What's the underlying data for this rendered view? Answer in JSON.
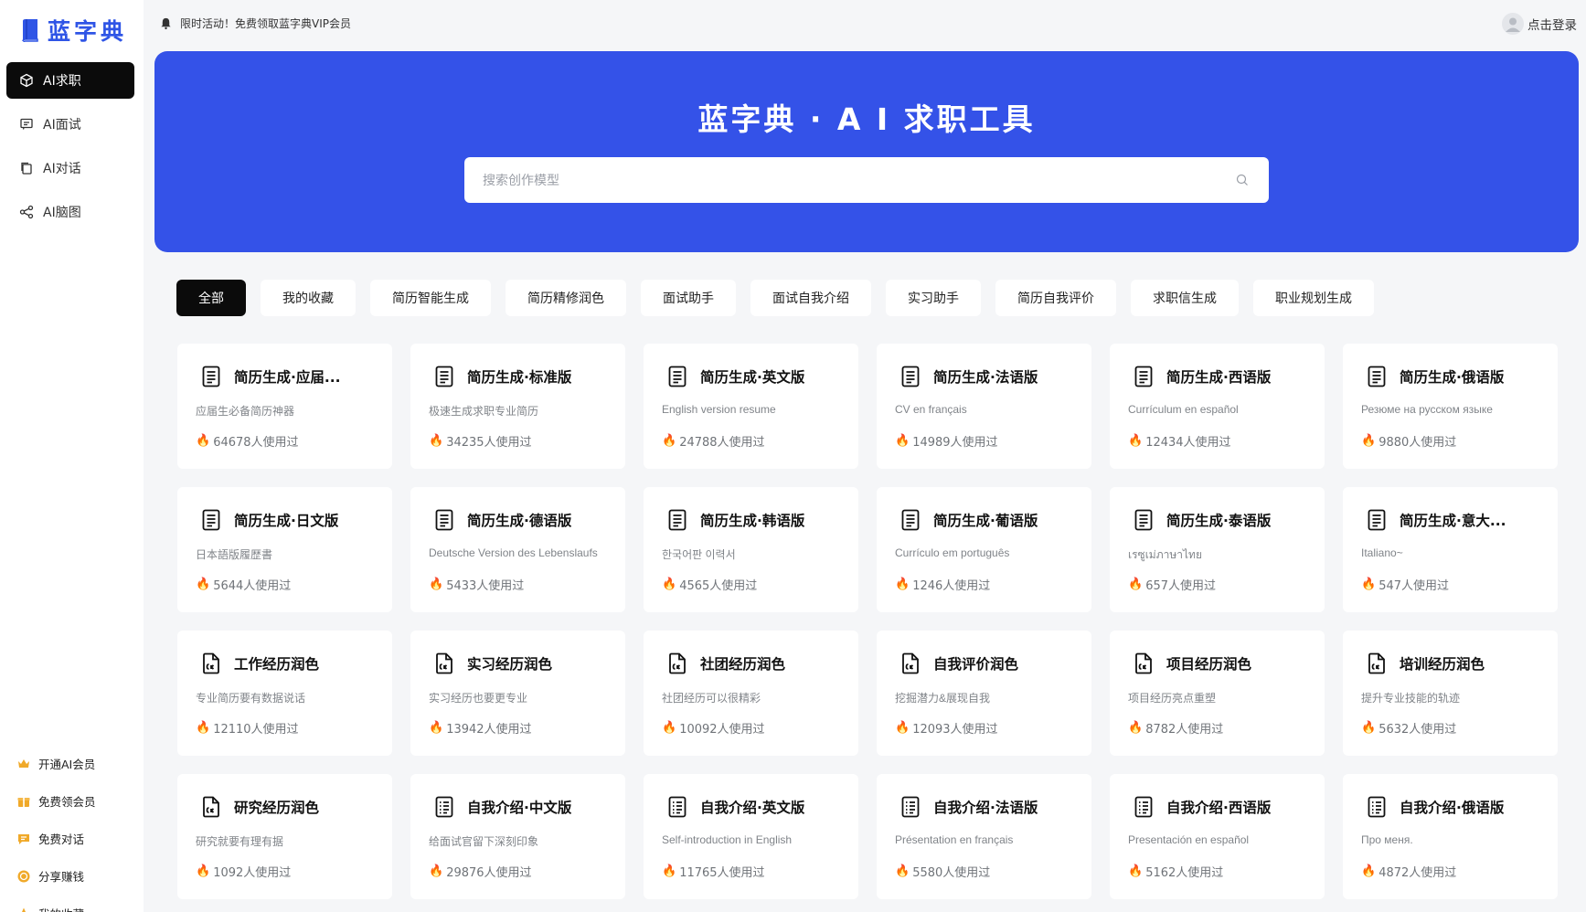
{
  "sidebar": {
    "logo_text": "蓝字典",
    "nav": [
      {
        "label": "AI求职",
        "icon": "cube-icon",
        "active": true
      },
      {
        "label": "AI面试",
        "icon": "message-icon",
        "active": false
      },
      {
        "label": "AI对话",
        "icon": "copy-icon",
        "active": false
      },
      {
        "label": "AI脑图",
        "icon": "mindmap-icon",
        "active": false
      }
    ],
    "bottom": [
      {
        "label": "开通AI会员",
        "icon": "crown-icon",
        "color": "#f0a929"
      },
      {
        "label": "免费领会员",
        "icon": "gift-icon",
        "color": "#f0a929"
      },
      {
        "label": "免费对话",
        "icon": "chat-icon",
        "color": "#f0a929"
      },
      {
        "label": "分享赚钱",
        "icon": "coin-icon",
        "color": "#f0a929"
      },
      {
        "label": "我的收藏",
        "icon": "star-icon",
        "color": "#f0a929"
      }
    ]
  },
  "topbar": {
    "promo": "限时活动！免费领取蓝字典VIP会员",
    "login": "点击登录"
  },
  "hero": {
    "title": "蓝字典 · A I 求职工具",
    "search_placeholder": "搜索创作模型"
  },
  "tabs": [
    {
      "label": "全部",
      "active": true
    },
    {
      "label": "我的收藏",
      "active": false
    },
    {
      "label": "简历智能生成",
      "active": false
    },
    {
      "label": "简历精修润色",
      "active": false
    },
    {
      "label": "面试助手",
      "active": false
    },
    {
      "label": "面试自我介绍",
      "active": false
    },
    {
      "label": "实习助手",
      "active": false
    },
    {
      "label": "简历自我评价",
      "active": false
    },
    {
      "label": "求职信生成",
      "active": false
    },
    {
      "label": "职业规划生成",
      "active": false
    }
  ],
  "cards": [
    {
      "title": "简历生成·应届...",
      "desc": "应届生必备简历神器",
      "usage": "64678人使用过",
      "icon": "resume-icon"
    },
    {
      "title": "简历生成·标准版",
      "desc": "极速生成求职专业简历",
      "usage": "34235人使用过",
      "icon": "resume-icon"
    },
    {
      "title": "简历生成·英文版",
      "desc": "English version resume",
      "usage": "24788人使用过",
      "icon": "resume-icon"
    },
    {
      "title": "简历生成·法语版",
      "desc": "CV en français",
      "usage": "14989人使用过",
      "icon": "resume-icon"
    },
    {
      "title": "简历生成·西语版",
      "desc": "Currículum en español",
      "usage": "12434人使用过",
      "icon": "resume-icon"
    },
    {
      "title": "简历生成·俄语版",
      "desc": "Резюме на русском языке",
      "usage": "9880人使用过",
      "icon": "resume-icon"
    },
    {
      "title": "简历生成·日文版",
      "desc": "日本語版履歴書",
      "usage": "5644人使用过",
      "icon": "resume-icon"
    },
    {
      "title": "简历生成·德语版",
      "desc": "Deutsche Version des Lebenslaufs",
      "usage": "5433人使用过",
      "icon": "resume-icon"
    },
    {
      "title": "简历生成·韩语版",
      "desc": "한국어판 이력서",
      "usage": "4565人使用过",
      "icon": "resume-icon"
    },
    {
      "title": "简历生成·葡语版",
      "desc": "Currículo em português",
      "usage": "1246人使用过",
      "icon": "resume-icon"
    },
    {
      "title": "简历生成·泰语版",
      "desc": "เรซูเม่ภาษาไทย",
      "usage": "657人使用过",
      "icon": "resume-icon"
    },
    {
      "title": "简历生成·意大...",
      "desc": "Italiano~",
      "usage": "547人使用过",
      "icon": "resume-icon"
    },
    {
      "title": "工作经历润色",
      "desc": "专业简历要有数据说话",
      "usage": "12110人使用过",
      "icon": "document-edit-icon"
    },
    {
      "title": "实习经历润色",
      "desc": "实习经历也要更专业",
      "usage": "13942人使用过",
      "icon": "document-edit-icon"
    },
    {
      "title": "社团经历润色",
      "desc": "社团经历可以很精彩",
      "usage": "10092人使用过",
      "icon": "document-edit-icon"
    },
    {
      "title": "自我评价润色",
      "desc": "挖掘潜力&展现自我",
      "usage": "12093人使用过",
      "icon": "document-edit-icon"
    },
    {
      "title": "项目经历润色",
      "desc": "项目经历亮点重塑",
      "usage": "8782人使用过",
      "icon": "document-edit-icon"
    },
    {
      "title": "培训经历润色",
      "desc": "提升专业技能的轨迹",
      "usage": "5632人使用过",
      "icon": "document-edit-icon"
    },
    {
      "title": "研究经历润色",
      "desc": "研究就要有理有据",
      "usage": "1092人使用过",
      "icon": "document-edit-icon"
    },
    {
      "title": "自我介绍·中文版",
      "desc": "给面试官留下深刻印象",
      "usage": "29876人使用过",
      "icon": "list-document-icon"
    },
    {
      "title": "自我介绍·英文版",
      "desc": "Self-introduction in English",
      "usage": "11765人使用过",
      "icon": "list-document-icon"
    },
    {
      "title": "自我介绍·法语版",
      "desc": "Présentation en français",
      "usage": "5580人使用过",
      "icon": "list-document-icon"
    },
    {
      "title": "自我介绍·西语版",
      "desc": "Presentación en español",
      "usage": "5162人使用过",
      "icon": "list-document-icon"
    },
    {
      "title": "自我介绍·俄语版",
      "desc": "Про меня.",
      "usage": "4872人使用过",
      "icon": "list-document-icon"
    }
  ],
  "colors": {
    "brand": "#2f55e6",
    "hero_bg": "#3452e8",
    "active": "#0b0b0b",
    "accent": "#f0a929"
  }
}
